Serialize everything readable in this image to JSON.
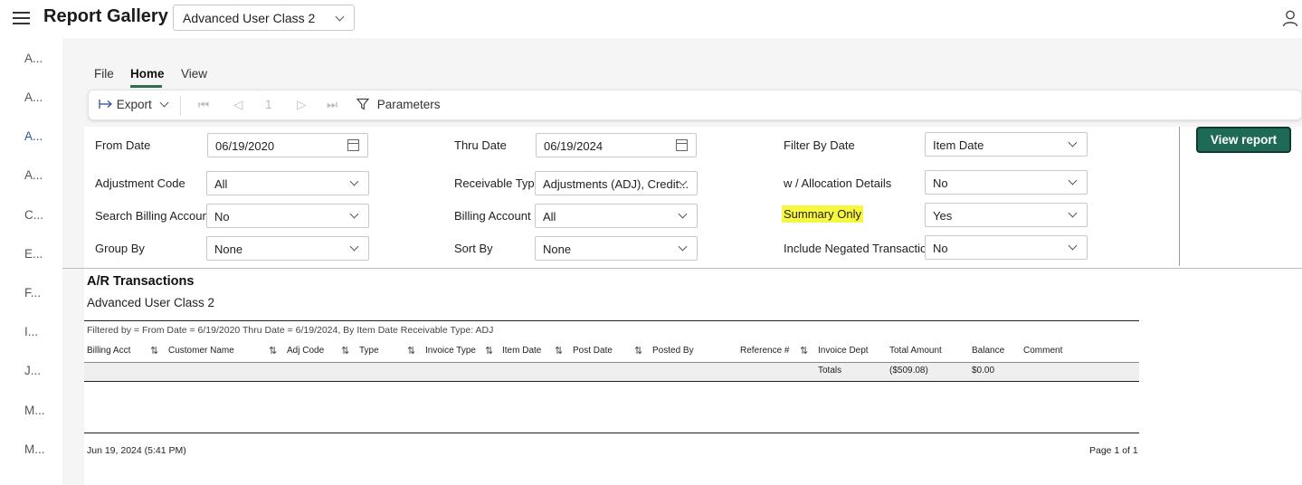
{
  "app": {
    "title": "Report Gallery",
    "selected_report": "Advanced User Class 2"
  },
  "leftnav": {
    "items": [
      "A...",
      "A...",
      "A...",
      "A...",
      "C...",
      "E...",
      "F...",
      "I...",
      "J...",
      "M...",
      "M..."
    ],
    "active_index": 2
  },
  "ribbon": {
    "tabs": [
      "File",
      "Home",
      "View"
    ],
    "active_tab": "Home"
  },
  "toolbar": {
    "export_label": "Export",
    "page_number": "1",
    "parameters_label": "Parameters"
  },
  "params": {
    "from_date": {
      "label": "From Date",
      "value": "06/19/2020"
    },
    "thru_date": {
      "label": "Thru Date",
      "value": "06/19/2024"
    },
    "filter_by_date": {
      "label": "Filter By Date",
      "value": "Item Date"
    },
    "adjustment_code": {
      "label": "Adjustment Code",
      "value": "All"
    },
    "receivable_type": {
      "label": "Receivable Type",
      "value": "Adjustments (ADJ), Credit..."
    },
    "allocation_details": {
      "label": "w / Allocation Details",
      "value": "No"
    },
    "search_billing_account": {
      "label": "Search Billing Account",
      "value": "No"
    },
    "billing_account": {
      "label": "Billing Account",
      "value": "All"
    },
    "summary_only": {
      "label": "Summary Only",
      "value": "Yes"
    },
    "group_by": {
      "label": "Group By",
      "value": "None"
    },
    "sort_by": {
      "label": "Sort By",
      "value": "None"
    },
    "include_negated": {
      "label": "Include Negated Transaction",
      "value": "No"
    },
    "view_report_label": "View report"
  },
  "report": {
    "title": "A/R Transactions",
    "subtitle": "Advanced User Class 2",
    "filter_text": "Filtered by = From Date = 6/19/2020 Thru Date = 6/19/2024, By  Item Date    Receivable Type: ADJ",
    "columns": [
      "Billing Acct",
      "Customer Name",
      "Adj Code",
      "Type",
      "Invoice Type",
      "Item Date",
      "Post Date",
      "Posted By",
      "Reference #",
      "Invoice Dept",
      "Total Amount",
      "Balance",
      "Comment"
    ],
    "totals": {
      "label": "Totals",
      "total_amount": "($509.08)",
      "balance": "$0.00"
    },
    "footer_left": "Jun 19, 2024 (5:41 PM)",
    "footer_right": "Page 1 of 1"
  },
  "colors": {
    "accent": "#1e6a56",
    "highlight": "#f7f740",
    "nav_active": "#2f52a0"
  }
}
